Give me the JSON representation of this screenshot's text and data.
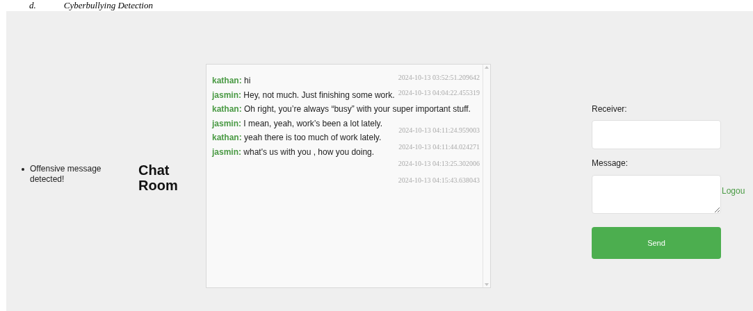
{
  "caption": {
    "number": "d.",
    "title": "Cyberbullying Detection"
  },
  "alerts": [
    "Offensive message detected!"
  ],
  "heading": "Chat Room",
  "messages": [
    {
      "sender": "kathan:",
      "text": "hi"
    },
    {
      "sender": "jasmin:",
      "text": "Hey, not much. Just finishing some work."
    },
    {
      "sender": "kathan:",
      "text": "Oh right, you’re always “busy” with your super important stuff."
    },
    {
      "sender": "jasmin:",
      "text": "I mean, yeah, work’s been a lot lately."
    },
    {
      "sender": "kathan:",
      "text": "yeah there is too much of work lately."
    },
    {
      "sender": "jasmin:",
      "text": "what's us with you , how you doing."
    }
  ],
  "timestamps": [
    "2024-10-13 03:52:51.209642",
    "2024-10-13 04:04:22.455319",
    "2024-10-13 04:11:24.959003",
    "2024-10-13 04:11:44.024271",
    "2024-10-13 04:13:25.302006",
    "2024-10-13 04:15:43.638043"
  ],
  "form": {
    "receiver_label": "Receiver:",
    "message_label": "Message:",
    "send": "Send",
    "logout": "Logou"
  }
}
